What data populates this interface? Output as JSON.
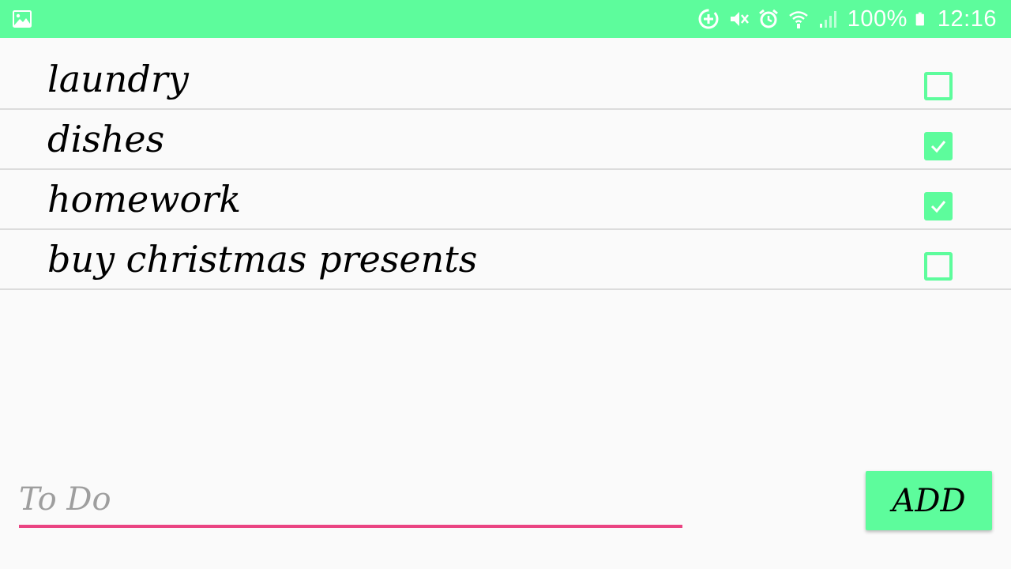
{
  "colors": {
    "accent": "#5dfc9c",
    "input_underline": "#ea4482",
    "background": "#fafafa",
    "divider": "#dcdcdc"
  },
  "status_bar": {
    "left_icon": "image-notification-icon",
    "icons": [
      "data-saver-icon",
      "vibrate-mute-icon",
      "alarm-icon",
      "wifi-icon",
      "cell-signal-icon",
      "battery-icon"
    ],
    "battery_text": "100%",
    "time": "12:16"
  },
  "todos": [
    {
      "label": "laundry",
      "checked": false
    },
    {
      "label": "dishes",
      "checked": true
    },
    {
      "label": "homework",
      "checked": true
    },
    {
      "label": "buy christmas presents",
      "checked": false
    }
  ],
  "input": {
    "placeholder": "To Do",
    "value": ""
  },
  "add_button": {
    "label": "ADD"
  }
}
